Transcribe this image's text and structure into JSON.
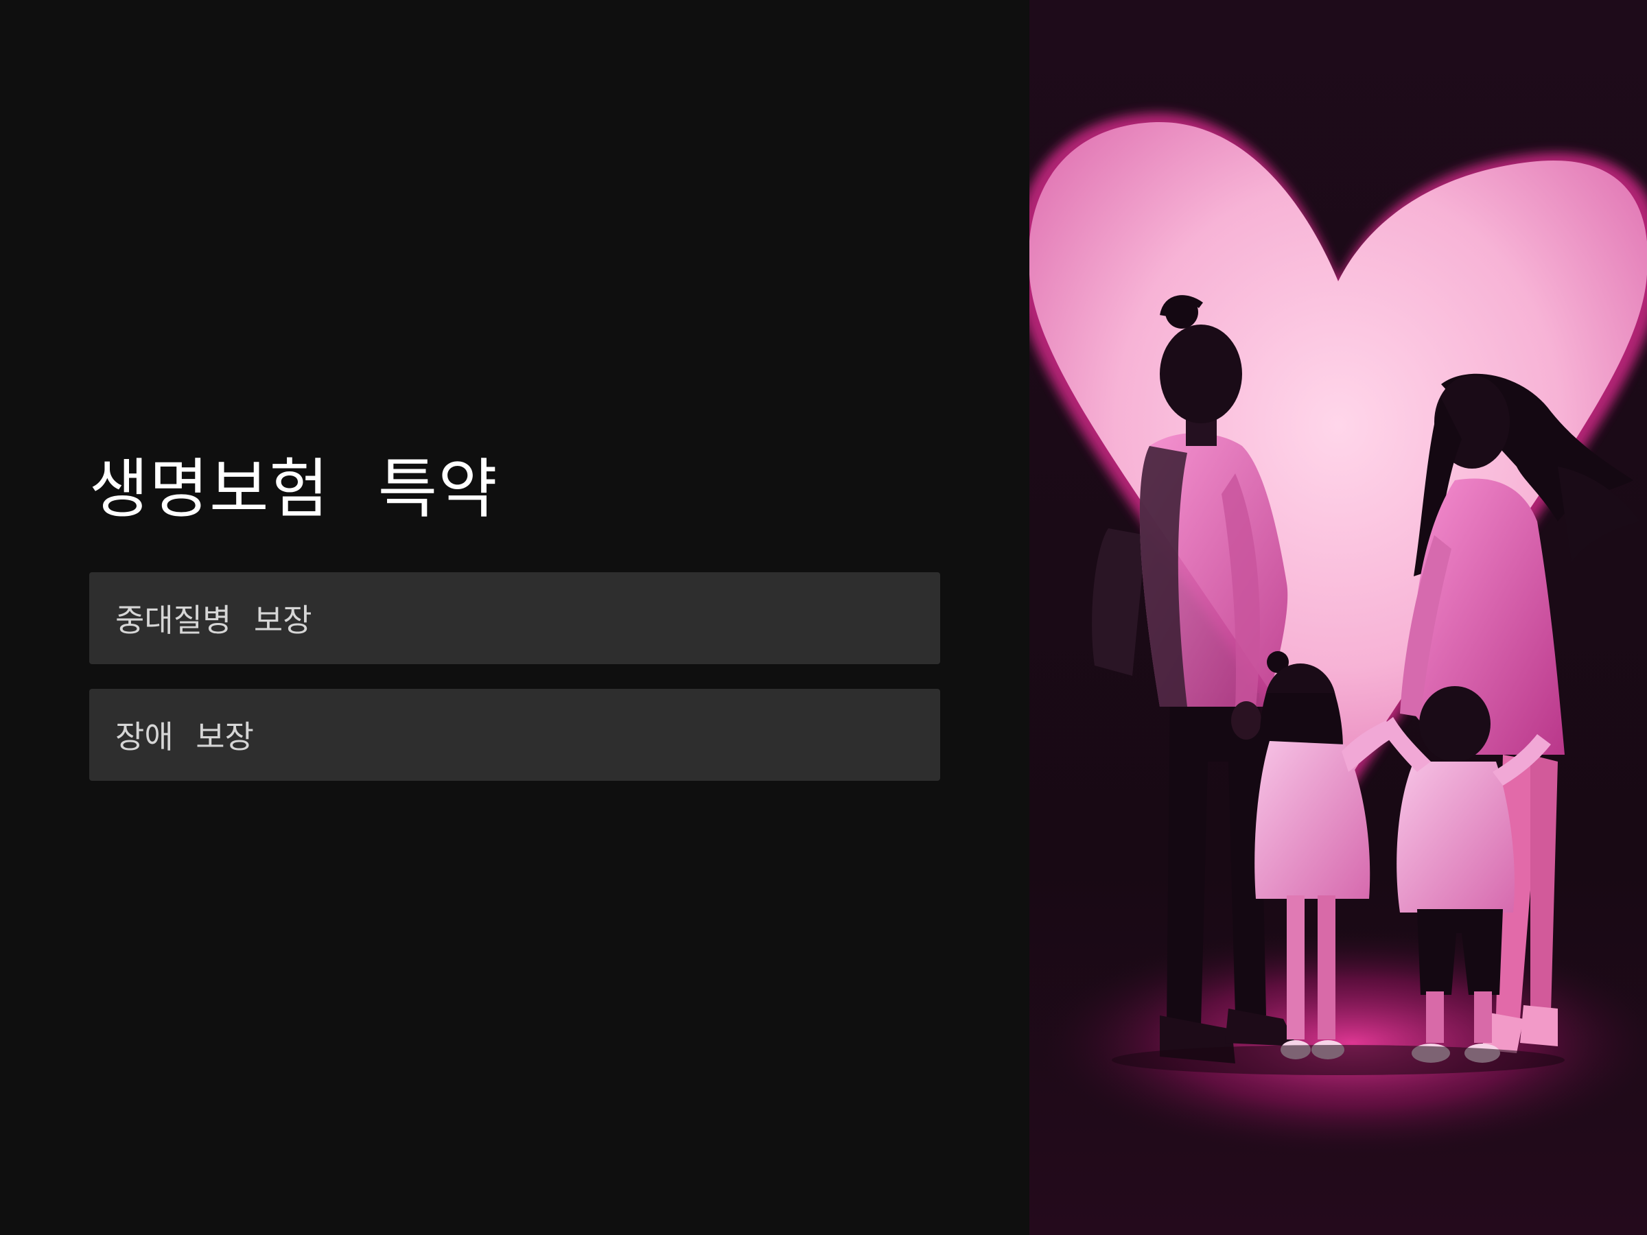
{
  "title": "생명보험 특약",
  "options": [
    {
      "label": "중대질병 보장"
    },
    {
      "label": "장애 보장"
    }
  ],
  "image": {
    "subject": "family-silhouette-heart",
    "colors": {
      "background_dark": "#1a0a16",
      "heart_pink": "#f7b9d9",
      "glow_magenta": "#ff3fa8",
      "silhouette": "#140812"
    }
  },
  "theme": {
    "background": "#0f0f0f",
    "option_background": "#2e2e2e",
    "title_color": "#ffffff",
    "option_text_color": "#d6d6d6"
  }
}
